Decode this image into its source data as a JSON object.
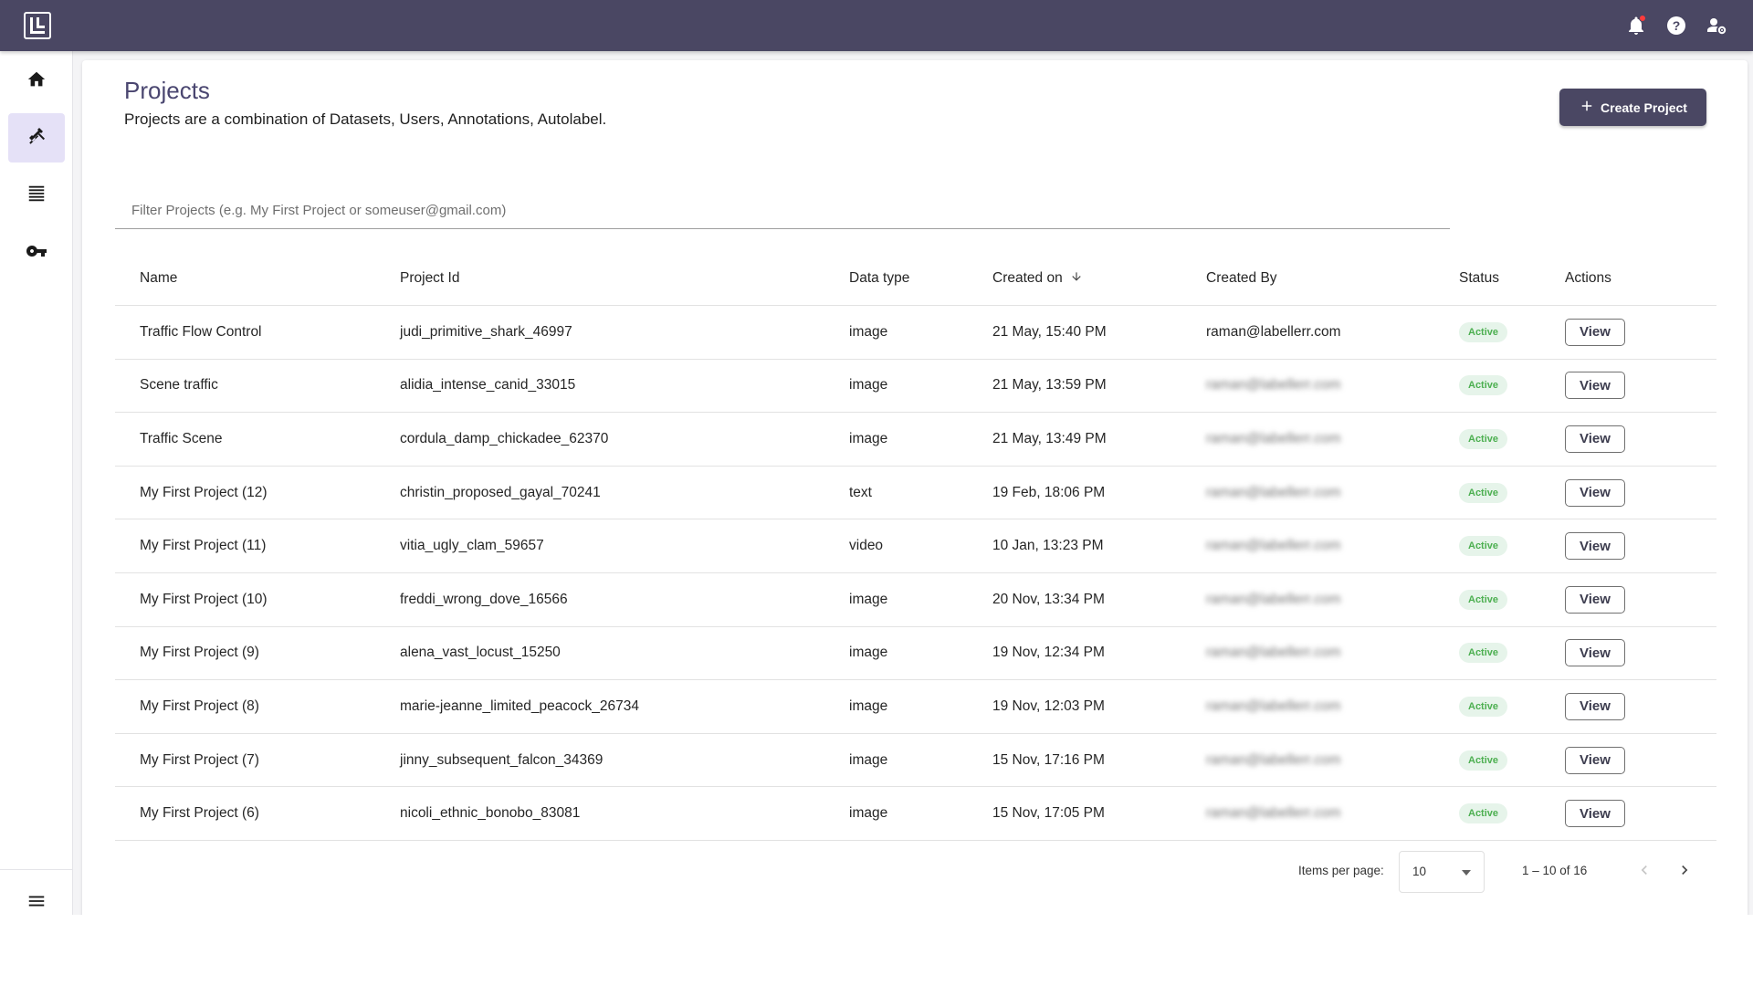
{
  "topbar": {
    "logo": "labellerr-logo-icon",
    "icons": [
      "notification-bell-icon",
      "help-icon",
      "account-settings-icon"
    ],
    "colors": {
      "bar": "#4a4763",
      "notification_dot": "#ff3b3b"
    }
  },
  "sidebar": {
    "items": [
      {
        "icon": "home-icon",
        "active": false
      },
      {
        "icon": "tools-icon",
        "active": true
      },
      {
        "icon": "list-icon",
        "active": false
      },
      {
        "icon": "key-icon",
        "active": false
      }
    ],
    "bottom_icon": "menu-icon",
    "colors": {
      "active_bg": "#e5e1f7"
    }
  },
  "header": {
    "title": "Projects",
    "subtitle": "Projects are a combination of Datasets, Users, Annotations, Autolabel.",
    "create_label": "Create Project"
  },
  "filter": {
    "placeholder": "Filter Projects (e.g. My First Project or someuser@gmail.com)"
  },
  "table": {
    "headers": {
      "name": "Name",
      "project_id": "Project Id",
      "data_type": "Data type",
      "created_on": "Created on",
      "created_by": "Created By",
      "status": "Status",
      "actions": "Actions"
    },
    "sort": {
      "column": "created_on",
      "direction": "descending"
    },
    "rows": [
      {
        "name": "Traffic Flow Control",
        "project_id": "judi_primitive_shark_46997",
        "data_type": "image",
        "created_on": "21 May, 15:40 PM",
        "created_by": "raman@labellerr.com",
        "blurred": false,
        "status": "Active",
        "action": "View"
      },
      {
        "name": "Scene traffic",
        "project_id": "alidia_intense_canid_33015",
        "data_type": "image",
        "created_on": "21 May, 13:59 PM",
        "created_by": "raman@labellerr.com",
        "blurred": true,
        "status": "Active",
        "action": "View"
      },
      {
        "name": "Traffic Scene",
        "project_id": "cordula_damp_chickadee_62370",
        "data_type": "image",
        "created_on": "21 May, 13:49 PM",
        "created_by": "raman@labellerr.com",
        "blurred": true,
        "status": "Active",
        "action": "View"
      },
      {
        "name": "My First Project (12)",
        "project_id": "christin_proposed_gayal_70241",
        "data_type": "text",
        "created_on": "19 Feb, 18:06 PM",
        "created_by": "raman@labellerr.com",
        "blurred": true,
        "status": "Active",
        "action": "View"
      },
      {
        "name": "My First Project (11)",
        "project_id": "vitia_ugly_clam_59657",
        "data_type": "video",
        "created_on": "10 Jan, 13:23 PM",
        "created_by": "raman@labellerr.com",
        "blurred": true,
        "status": "Active",
        "action": "View"
      },
      {
        "name": "My First Project (10)",
        "project_id": "freddi_wrong_dove_16566",
        "data_type": "image",
        "created_on": "20 Nov, 13:34 PM",
        "created_by": "raman@labellerr.com",
        "blurred": true,
        "status": "Active",
        "action": "View"
      },
      {
        "name": "My First Project (9)",
        "project_id": "alena_vast_locust_15250",
        "data_type": "image",
        "created_on": "19 Nov, 12:34 PM",
        "created_by": "raman@labellerr.com",
        "blurred": true,
        "status": "Active",
        "action": "View"
      },
      {
        "name": "My First Project (8)",
        "project_id": "marie-jeanne_limited_peacock_26734",
        "data_type": "image",
        "created_on": "19 Nov, 12:03 PM",
        "created_by": "raman@labellerr.com",
        "blurred": true,
        "status": "Active",
        "action": "View"
      },
      {
        "name": "My First Project (7)",
        "project_id": "jinny_subsequent_falcon_34369",
        "data_type": "image",
        "created_on": "15 Nov, 17:16 PM",
        "created_by": "raman@labellerr.com",
        "blurred": true,
        "status": "Active",
        "action": "View"
      },
      {
        "name": "My First Project (6)",
        "project_id": "nicoli_ethnic_bonobo_83081",
        "data_type": "image",
        "created_on": "15 Nov, 17:05 PM",
        "created_by": "raman@labellerr.com",
        "blurred": true,
        "status": "Active",
        "action": "View"
      }
    ]
  },
  "pagination": {
    "items_per_page_label": "Items per page:",
    "items_per_page": "10",
    "range": "1 – 10 of 16",
    "prev_icon": "chevron-left-icon",
    "next_icon": "chevron-right-icon"
  },
  "colors": {
    "primary": "#4a4763",
    "title": "#4a4670",
    "active_badge_bg": "#e6f4ea",
    "active_badge_text": "#4caf50"
  }
}
